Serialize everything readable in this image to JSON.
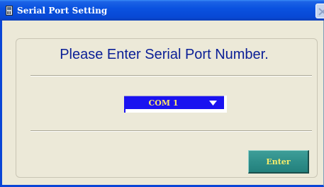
{
  "window": {
    "title": "Serial Port Setting",
    "title_icon": "serial-port-app-icon",
    "close_icon": "close-icon"
  },
  "dialog": {
    "heading": "Please Enter Serial Port Number.",
    "port_select": {
      "selected_value": "COM 1",
      "arrow_icon": "dropdown-arrow-icon"
    },
    "enter_button_label": "Enter"
  },
  "colors": {
    "titlebar": "#0a52e0",
    "window_bg": "#ece9d8",
    "heading_text": "#0a1e96",
    "select_bg": "#1a12f0",
    "select_text": "#ffe66a",
    "button_bg": "#2e8e8a",
    "button_text": "#f6ec6a"
  }
}
